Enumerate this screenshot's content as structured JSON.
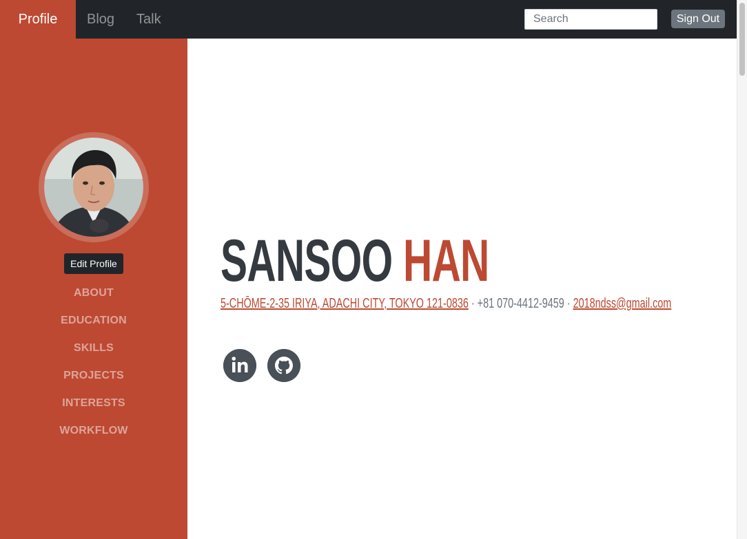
{
  "navbar": {
    "tabs": [
      {
        "label": "Profile",
        "active": true
      },
      {
        "label": "Blog",
        "active": false
      },
      {
        "label": "Talk",
        "active": false
      }
    ],
    "search": {
      "placeholder": "Search",
      "value": ""
    },
    "signout_label": "Sign Out"
  },
  "sidebar": {
    "edit_profile_label": "Edit Profile",
    "nav_items": [
      "ABOUT",
      "EDUCATION",
      "SKILLS",
      "PROJECTS",
      "INTERESTS",
      "WORKFLOW"
    ]
  },
  "profile": {
    "first_name": "SANSOO",
    "last_name": "HAN",
    "address": "5-chōme-2-35 Iriya, Adachi City, Tokyo 121-0836",
    "separator": " · ",
    "phone": "+81 070-4412-9459",
    "email": "2018ndss@gmail.com"
  },
  "social": [
    {
      "icon": "linkedin-icon"
    },
    {
      "icon": "github-icon"
    }
  ],
  "colors": {
    "accent": "#bd4932",
    "navbar_bg": "#212529",
    "name_dark": "#343a40",
    "social_bg": "#495057"
  }
}
